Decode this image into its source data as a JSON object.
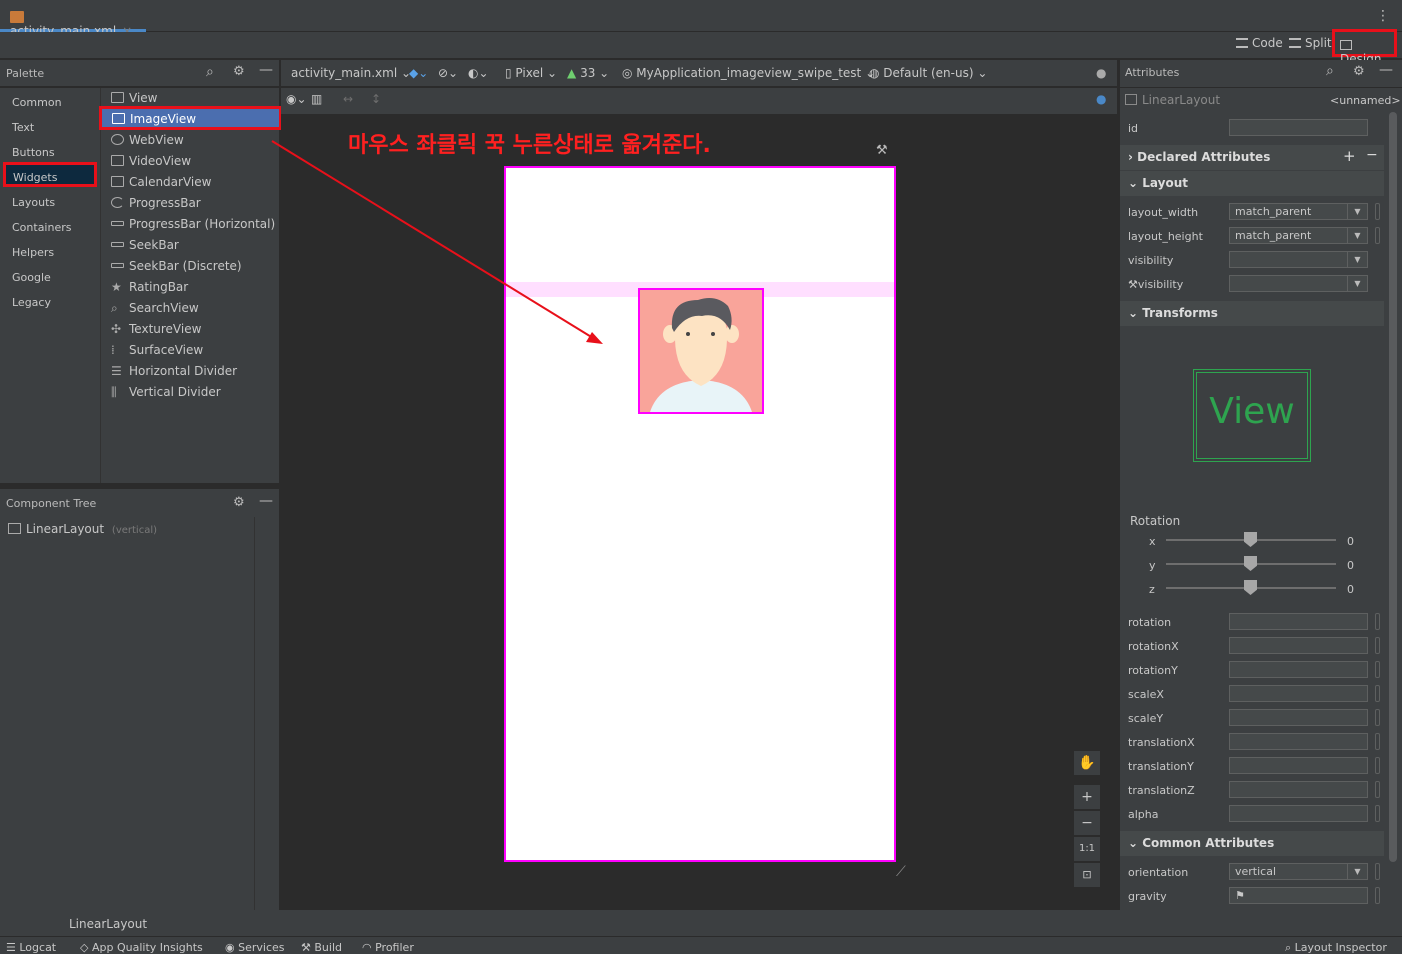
{
  "tab": {
    "file_name": "activity_main.xml",
    "close": "×"
  },
  "modes": {
    "code": "Code",
    "split": "Split",
    "design": "Design"
  },
  "palette": {
    "title": "Palette",
    "categories": [
      "Common",
      "Text",
      "Buttons",
      "Widgets",
      "Layouts",
      "Containers",
      "Helpers",
      "Google",
      "Legacy"
    ],
    "selected_category": "Widgets",
    "items": [
      "View",
      "ImageView",
      "WebView",
      "VideoView",
      "CalendarView",
      "ProgressBar",
      "ProgressBar (Horizontal)",
      "SeekBar",
      "SeekBar (Discrete)",
      "RatingBar",
      "SearchView",
      "TextureView",
      "SurfaceView",
      "Horizontal Divider",
      "Vertical Divider"
    ],
    "selected_item": "ImageView"
  },
  "component_tree": {
    "title": "Component Tree",
    "root_label": "LinearLayout",
    "root_hint": "(vertical)"
  },
  "design_toolbar": {
    "file": "activity_main.xml",
    "device": "Pixel",
    "api": "33",
    "theme": "MyApplication_imageview_swipe_test",
    "locale": "Default (en-us)"
  },
  "annotation_text": "마우스 좌클릭 꾹 누른상태로 옮겨준다.",
  "zoom": {
    "hand": "✋",
    "plus": "+",
    "minus": "−",
    "one_to_one": "1:1"
  },
  "attributes": {
    "title": "Attributes",
    "component": "LinearLayout",
    "component_name": "<unnamed>",
    "id_label": "id",
    "sections": {
      "declared": "Declared Attributes",
      "layout": "Layout",
      "transforms": "Transforms",
      "common": "Common Attributes"
    },
    "layout_rows": [
      {
        "label": "layout_width",
        "value": "match_parent"
      },
      {
        "label": "layout_height",
        "value": "match_parent"
      },
      {
        "label": "visibility",
        "value": ""
      },
      {
        "label": "visibility",
        "value": ""
      }
    ],
    "preview_text": "View",
    "rotation_label": "Rotation",
    "rotation_axes": [
      {
        "axis": "x",
        "value": "0"
      },
      {
        "axis": "y",
        "value": "0"
      },
      {
        "axis": "z",
        "value": "0"
      }
    ],
    "transform_fields": [
      "rotation",
      "rotationX",
      "rotationY",
      "scaleX",
      "scaleY",
      "translationX",
      "translationY",
      "translationZ",
      "alpha"
    ],
    "common_rows": [
      {
        "label": "orientation",
        "value": "vertical"
      },
      {
        "label": "gravity",
        "value": ""
      }
    ]
  },
  "status": {
    "breadcrumb": "LinearLayout",
    "tools": [
      "Logcat",
      "App Quality Insights",
      "Services",
      "Build",
      "Profiler"
    ],
    "right_tool": "Layout Inspector"
  },
  "colors": {
    "highlight_red": "#e8101a",
    "selection_magenta": "#ff00ff",
    "selected_item_bg": "#4b6eaf"
  }
}
